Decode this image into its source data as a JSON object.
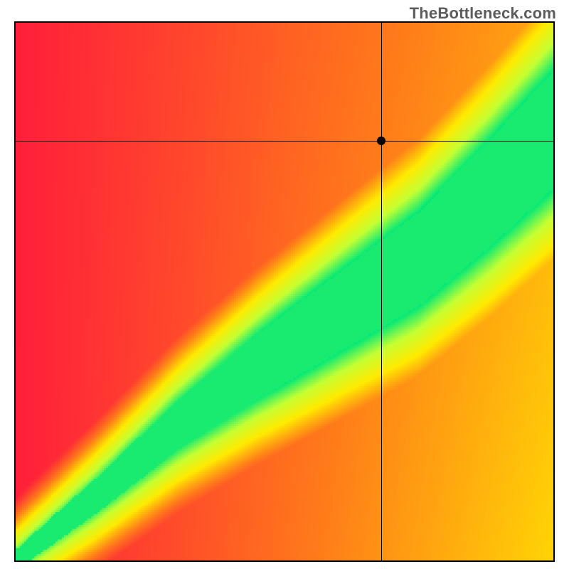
{
  "watermark": "TheBottleneck.com",
  "chart_data": {
    "type": "heatmap",
    "title": "",
    "xlabel": "",
    "ylabel": "",
    "xlim": [
      0,
      100
    ],
    "ylim": [
      0,
      100
    ],
    "crosshair": {
      "x": 68,
      "y": 78
    },
    "marker": {
      "x": 68,
      "y": 78
    },
    "colorscale": [
      {
        "stop": 0.0,
        "color": "#ff1f3a"
      },
      {
        "stop": 0.25,
        "color": "#ff7a1a"
      },
      {
        "stop": 0.5,
        "color": "#ffea00"
      },
      {
        "stop": 0.75,
        "color": "#c4ff33"
      },
      {
        "stop": 1.0,
        "color": "#00e878"
      }
    ],
    "ridge": {
      "description": "Green optimum band running diagonally from bottom-left to top-right; values fall off toward red away from the ridge.",
      "centerline": [
        {
          "x": 0,
          "y": 0
        },
        {
          "x": 15,
          "y": 12
        },
        {
          "x": 30,
          "y": 25
        },
        {
          "x": 45,
          "y": 36
        },
        {
          "x": 60,
          "y": 46
        },
        {
          "x": 75,
          "y": 56
        },
        {
          "x": 88,
          "y": 68
        },
        {
          "x": 100,
          "y": 80
        }
      ],
      "half_width_start": 2,
      "half_width_end": 11
    },
    "corner_bias": {
      "bottom_right_warm": 0.45,
      "top_right_warm": 0.35
    }
  }
}
